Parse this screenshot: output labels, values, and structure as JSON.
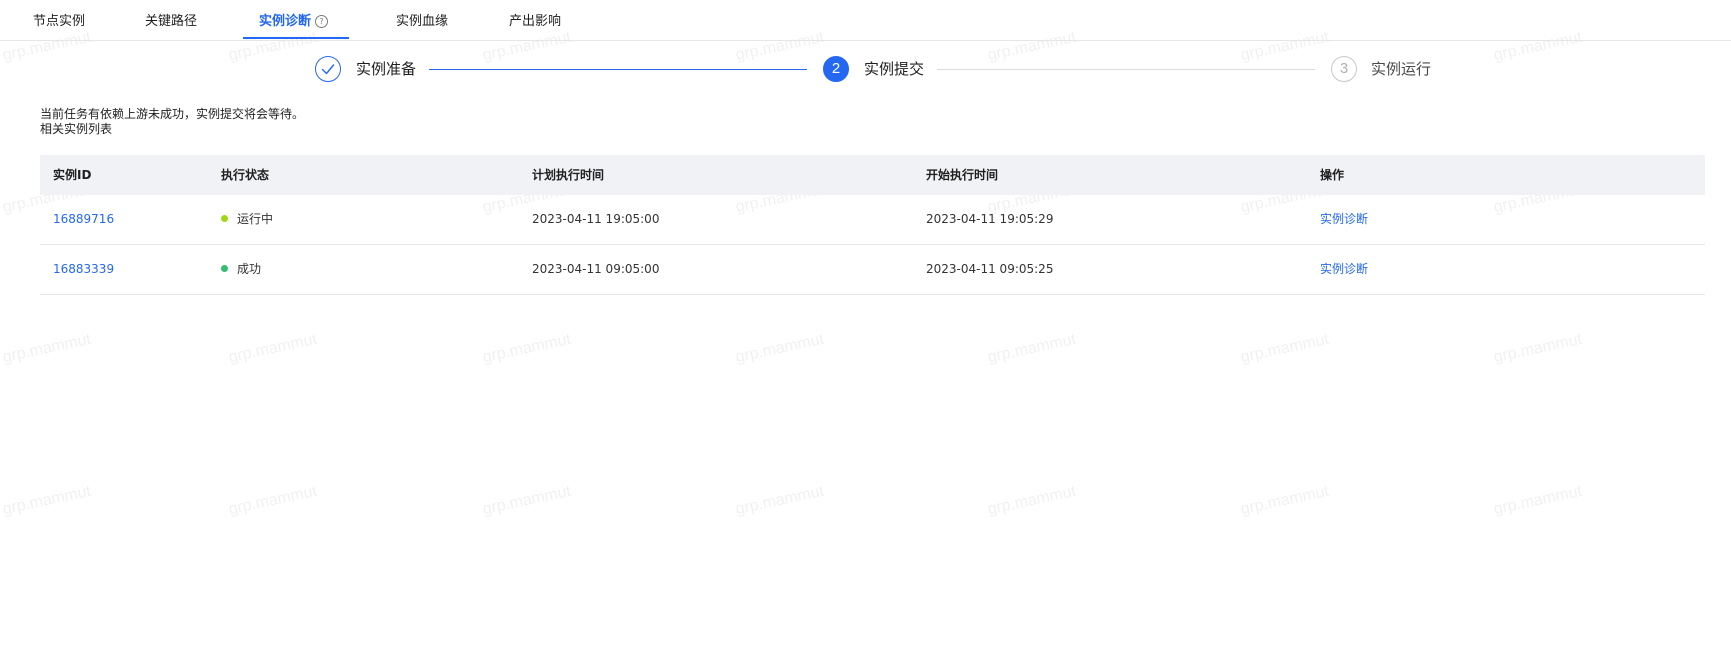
{
  "tabs": [
    {
      "label": "节点实例"
    },
    {
      "label": "关键路径"
    },
    {
      "label": "实例诊断"
    },
    {
      "label": "实例血缘"
    },
    {
      "label": "产出影响"
    }
  ],
  "active_tab_index": 2,
  "help_icon_glyph": "?",
  "steps": [
    {
      "label": "实例准备",
      "status": "done"
    },
    {
      "label": "实例提交",
      "number": "2",
      "status": "active"
    },
    {
      "label": "实例运行",
      "number": "3",
      "status": "pending"
    }
  ],
  "messages": {
    "notice": "当前任务有依赖上游未成功，实例提交将会等待。",
    "list_title": "相关实例列表"
  },
  "table": {
    "headers": {
      "id": "实例ID",
      "status": "执行状态",
      "planned_time": "计划执行时间",
      "start_time": "开始执行时间",
      "action": "操作"
    },
    "rows": [
      {
        "id": "16889716",
        "status": "运行中",
        "status_color": "#a0d911",
        "planned_time": "2023-04-11 19:05:00",
        "start_time": "2023-04-11 19:05:29",
        "action": "实例诊断"
      },
      {
        "id": "16883339",
        "status": "成功",
        "status_color": "#2fbf71",
        "planned_time": "2023-04-11 09:05:00",
        "start_time": "2023-04-11 09:05:25",
        "action": "实例诊断"
      }
    ]
  },
  "watermark": "grp.mammut",
  "colors": {
    "accent": "#2468f2",
    "header_bg": "#f1f2f5"
  }
}
